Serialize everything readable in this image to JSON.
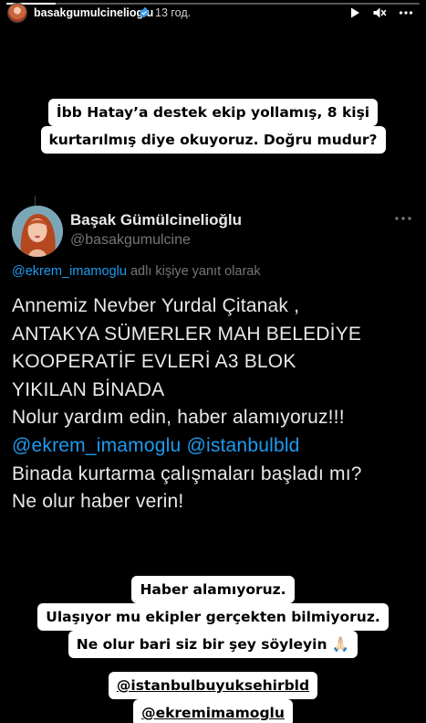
{
  "story": {
    "progress_fraction": 0.12,
    "username": "basakgumulcinelioglu",
    "time": "13 год.",
    "icons": {
      "avatar": "profile-avatar",
      "verified": "verified-badge-icon",
      "play": "play-icon",
      "mute": "mute-icon",
      "more": "more-icon"
    }
  },
  "caption_top": {
    "line1": "İbb Hatay’a destek ekip yollamış, 8 kişi",
    "line2": "kurtarılmış diye okuyoruz. Doğru mudur?"
  },
  "tweet": {
    "name": "Başak Gümülcinelioğlu",
    "handle": "@basakgumulcine",
    "reply_mention": "@ekrem_imamoglu",
    "reply_suffix": " adlı kişiye yanıt olarak",
    "lines": [
      "Annemiz Nevber Yurdal Çitanak ,",
      "ANTAKYA SÜMERLER MAH BELEDİYE",
      "KOOPERATİF EVLERİ A3 BLOK",
      "YIKILAN BİNADA",
      "Nolur yardım edin, haber alamıyoruz!!!"
    ],
    "mention1": "@ekrem_imamoglu",
    "mention2": "@istanbulbld",
    "line_after1": "Binada kurtarma çalışmaları başladı mı?",
    "line_after2": "Ne olur haber verin!"
  },
  "caption_bottom": {
    "line1": "Haber alamıyoruz.",
    "line2": "Ulaşıyor mu ekipler gerçekten bilmiyoruz.",
    "line3": "Ne olur bari siz bir şey söyleyin 🙏🏻"
  },
  "caption_mentions": {
    "line1": "@istanbulbuyuksehirbld",
    "line2": "@ekremimamoglu"
  },
  "colors": {
    "background": "#000000",
    "mention_blue": "#1d9bf0",
    "handle_gray": "#71767b",
    "caption_bg": "#ffffff"
  }
}
